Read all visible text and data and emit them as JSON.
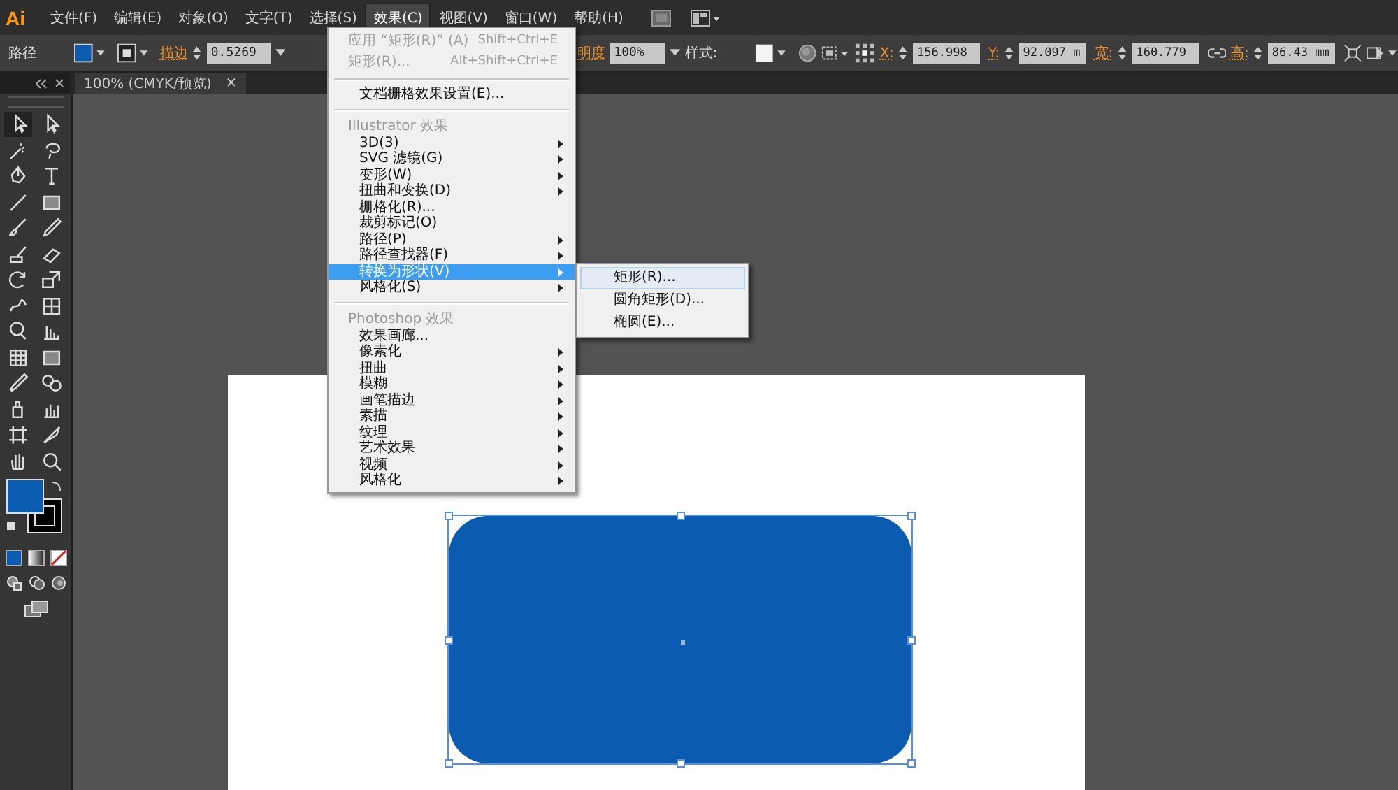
{
  "menubar": {
    "logo": "Ai",
    "items": [
      {
        "label": "文件(F)",
        "selected": false
      },
      {
        "label": "编辑(E)",
        "selected": false
      },
      {
        "label": "对象(O)",
        "selected": false
      },
      {
        "label": "文字(T)",
        "selected": false
      },
      {
        "label": "选择(S)",
        "selected": false
      },
      {
        "label": "效果(C)",
        "selected": true
      },
      {
        "label": "视图(V)",
        "selected": false
      },
      {
        "label": "窗口(W)",
        "selected": false
      },
      {
        "label": "帮助(H)",
        "selected": false
      }
    ]
  },
  "control_bar": {
    "object_type": "路径",
    "stroke_label": "描边",
    "stroke_weight": "0.5269",
    "opacity_label": "明度",
    "opacity": "100%",
    "style_label": "样式:",
    "fields": [
      {
        "label": "X:",
        "value": "156.998"
      },
      {
        "label": "Y:",
        "value": "92.097 m"
      },
      {
        "label": "宽:",
        "value": "160.779"
      },
      {
        "label": "高:",
        "value": "86.43 mm"
      }
    ]
  },
  "document_tab": {
    "title": "100% (CMYK/预览)",
    "close": "×"
  },
  "effect_menu": [
    {
      "kind": "item",
      "label": "应用 “矩形(R)” (A)",
      "shortcut": "Shift+Ctrl+E",
      "disabled": true,
      "submenu": false,
      "selected": false
    },
    {
      "kind": "item",
      "label": "矩形(R)...",
      "shortcut": "Alt+Shift+Ctrl+E",
      "disabled": true,
      "submenu": false,
      "selected": false
    },
    {
      "kind": "separator"
    },
    {
      "kind": "item",
      "label": "文档栅格效果设置(E)...",
      "disabled": false,
      "submenu": false,
      "selected": false
    },
    {
      "kind": "separator"
    },
    {
      "kind": "header",
      "label": "Illustrator 效果"
    },
    {
      "kind": "item",
      "label": "3D(3)",
      "disabled": false,
      "submenu": true,
      "selected": false
    },
    {
      "kind": "item",
      "label": "SVG 滤镜(G)",
      "disabled": false,
      "submenu": true,
      "selected": false
    },
    {
      "kind": "item",
      "label": "变形(W)",
      "disabled": false,
      "submenu": true,
      "selected": false
    },
    {
      "kind": "item",
      "label": "扭曲和变换(D)",
      "disabled": false,
      "submenu": true,
      "selected": false
    },
    {
      "kind": "item",
      "label": "栅格化(R)...",
      "disabled": false,
      "submenu": false,
      "selected": false
    },
    {
      "kind": "item",
      "label": "裁剪标记(O)",
      "disabled": false,
      "submenu": false,
      "selected": false
    },
    {
      "kind": "item",
      "label": "路径(P)",
      "disabled": false,
      "submenu": true,
      "selected": false
    },
    {
      "kind": "item",
      "label": "路径查找器(F)",
      "disabled": false,
      "submenu": true,
      "selected": false
    },
    {
      "kind": "item",
      "label": "转换为形状(V)",
      "disabled": false,
      "submenu": true,
      "selected": true
    },
    {
      "kind": "item",
      "label": "风格化(S)",
      "disabled": false,
      "submenu": true,
      "selected": false
    },
    {
      "kind": "separator"
    },
    {
      "kind": "header",
      "label": "Photoshop 效果"
    },
    {
      "kind": "item",
      "label": "效果画廊...",
      "disabled": false,
      "submenu": false,
      "selected": false
    },
    {
      "kind": "item",
      "label": "像素化",
      "disabled": false,
      "submenu": true,
      "selected": false
    },
    {
      "kind": "item",
      "label": "扭曲",
      "disabled": false,
      "submenu": true,
      "selected": false
    },
    {
      "kind": "item",
      "label": "模糊",
      "disabled": false,
      "submenu": true,
      "selected": false
    },
    {
      "kind": "item",
      "label": "画笔描边",
      "disabled": false,
      "submenu": true,
      "selected": false
    },
    {
      "kind": "item",
      "label": "素描",
      "disabled": false,
      "submenu": true,
      "selected": false
    },
    {
      "kind": "item",
      "label": "纹理",
      "disabled": false,
      "submenu": true,
      "selected": false
    },
    {
      "kind": "item",
      "label": "艺术效果",
      "disabled": false,
      "submenu": true,
      "selected": false
    },
    {
      "kind": "item",
      "label": "视频",
      "disabled": false,
      "submenu": true,
      "selected": false
    },
    {
      "kind": "item",
      "label": "风格化",
      "disabled": false,
      "submenu": true,
      "selected": false
    }
  ],
  "shape_submenu": [
    {
      "label": "矩形(R)...",
      "selected": true
    },
    {
      "label": "圆角矩形(D)...",
      "selected": false
    },
    {
      "label": "椭圆(E)...",
      "selected": false
    }
  ]
}
